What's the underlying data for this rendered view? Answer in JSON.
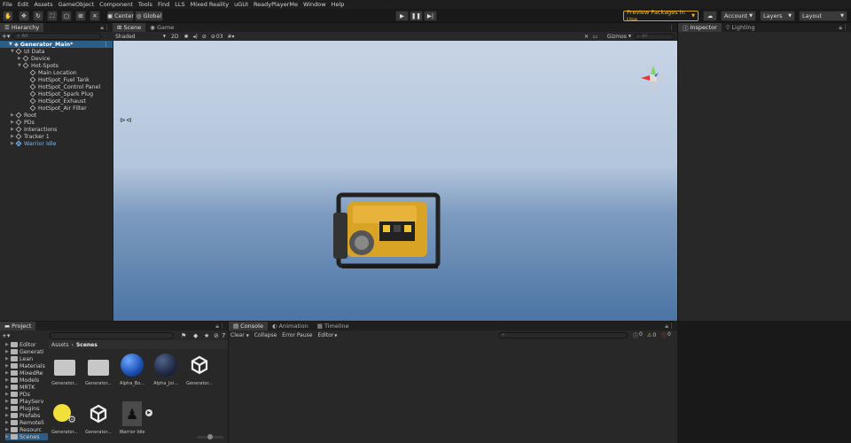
{
  "menu": [
    "File",
    "Edit",
    "Assets",
    "GameObject",
    "Component",
    "Tools",
    "Find",
    "LLS",
    "Mixed Reality",
    "uGUI",
    "ReadyPlayerMe",
    "Window",
    "Help"
  ],
  "toolbar": {
    "pivot_label": "Center",
    "space_label": "Global",
    "preview_packages_label": "Preview Packages in Use",
    "account_label": "Account",
    "layers_label": "Layers",
    "layout_label": "Layout"
  },
  "hierarchy": {
    "tab_label": "Hierarchy",
    "search_placeholder": "All",
    "scene_name": "Generator_Main*",
    "items": [
      {
        "label": "UI Data",
        "depth": 1,
        "expanded": true
      },
      {
        "label": "Device",
        "depth": 2,
        "expanded": false
      },
      {
        "label": "Hot-Spots",
        "depth": 2,
        "expanded": true
      },
      {
        "label": "Main Location",
        "depth": 3
      },
      {
        "label": "HotSpot_Fuel Tank",
        "depth": 3
      },
      {
        "label": "HotSpot_Control Panel",
        "depth": 3
      },
      {
        "label": "HotSpot_Spark Plug",
        "depth": 3
      },
      {
        "label": "HotSpot_Exhaust",
        "depth": 3
      },
      {
        "label": "HotSpot_Air Filter",
        "depth": 3
      },
      {
        "label": "Root",
        "depth": 1,
        "expanded": false
      },
      {
        "label": "PDs",
        "depth": 1,
        "expanded": false
      },
      {
        "label": "Interactions",
        "depth": 1,
        "expanded": false
      },
      {
        "label": "Tracker 1",
        "depth": 1,
        "expanded": false
      },
      {
        "label": "Warrior Idle",
        "depth": 1,
        "expanded": false,
        "prefab": true
      }
    ]
  },
  "scene": {
    "tab_scene": "Scene",
    "tab_game": "Game",
    "shading_mode": "Shaded",
    "mode_2d": "2D",
    "fx_count": "03",
    "gizmos_label": "Gizmos",
    "search_placeholder": "All"
  },
  "inspector": {
    "tab_inspector": "Inspector",
    "tab_lighting": "Lighting"
  },
  "project": {
    "tab_label": "Project",
    "breadcrumb_root": "Assets",
    "breadcrumb_current": "Scenes",
    "hidden_count": "7",
    "folders": [
      "Editor",
      "Generati",
      "Lean",
      "Materials",
      "MixedRe",
      "Models",
      "MRTK",
      "PDs",
      "PlayServ",
      "Plugins",
      "Prefabs",
      "Remoteli",
      "Resourc",
      "Scenes"
    ],
    "assets": [
      {
        "name": "Generator...",
        "kind": "folder"
      },
      {
        "name": "Generator...",
        "kind": "folder"
      },
      {
        "name": "Alpha_Bo...",
        "kind": "sphere-blue"
      },
      {
        "name": "Alpha_Joi...",
        "kind": "sphere-dark"
      },
      {
        "name": "Generator...",
        "kind": "unity"
      },
      {
        "name": "Generator...",
        "kind": "lighting"
      },
      {
        "name": "Generator...",
        "kind": "unity"
      },
      {
        "name": "Warrior Idle",
        "kind": "model"
      }
    ]
  },
  "console": {
    "tab_console": "Console",
    "tab_animation": "Animation",
    "tab_timeline": "Timeline",
    "clear_label": "Clear",
    "collapse_label": "Collapse",
    "error_pause_label": "Error Pause",
    "editor_label": "Editor",
    "count_errors": "0",
    "count_warnings": "0",
    "count_logs": "0"
  },
  "colors": {
    "preview_border": "#d9a21b",
    "selection": "#2c5d87",
    "prefab_text": "#7cb5f0"
  }
}
